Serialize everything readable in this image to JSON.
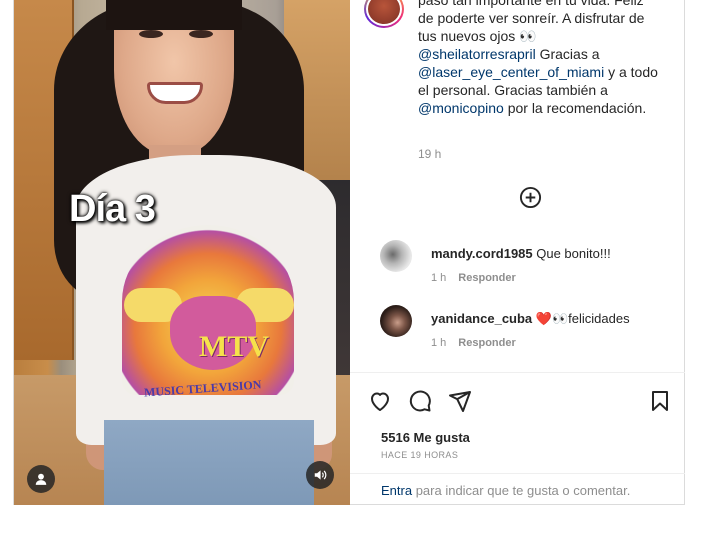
{
  "media": {
    "overlay_text": "Día 3",
    "shirt_print_text": "MUSIC TELEVISION",
    "shirt_logo_text": "MTV",
    "icons": {
      "user_tag": "user-icon",
      "sound": "speaker-icon"
    }
  },
  "caption": {
    "line1": "paso tan importante en tu vida. Feliz",
    "line2": "de poderte ver sonreír. A disfrutar de",
    "line3": "tus nuevos ojos 👀",
    "mention1": "@sheilatorresrapril",
    "line4_rest": " Gracias a",
    "mention2": "@laser_eye_center_of_miami",
    "line5_rest": " y a todo",
    "line6": "el personal. Gracias también a",
    "mention3": "@monicopino",
    "line7_rest": " por la recomendación.",
    "time": "19 h"
  },
  "more_comments": {
    "icon": "plus-circle-icon"
  },
  "comments": [
    {
      "user": "mandy.cord1985",
      "text": " Que bonito!!!",
      "time": "1 h",
      "reply": "Responder"
    },
    {
      "user": "yanidance_cuba",
      "text": " ❤️👀felicidades",
      "time": "1 h",
      "reply": "Responder"
    }
  ],
  "actions": {
    "icons": [
      "heart-icon",
      "comment-icon",
      "share-icon",
      "bookmark-icon"
    ]
  },
  "likes": "5516 Me gusta",
  "time_ago": "HACE 19 HORAS",
  "add_comment": {
    "link": "Entra",
    "rest": " para indicar que te gusta o comentar."
  }
}
